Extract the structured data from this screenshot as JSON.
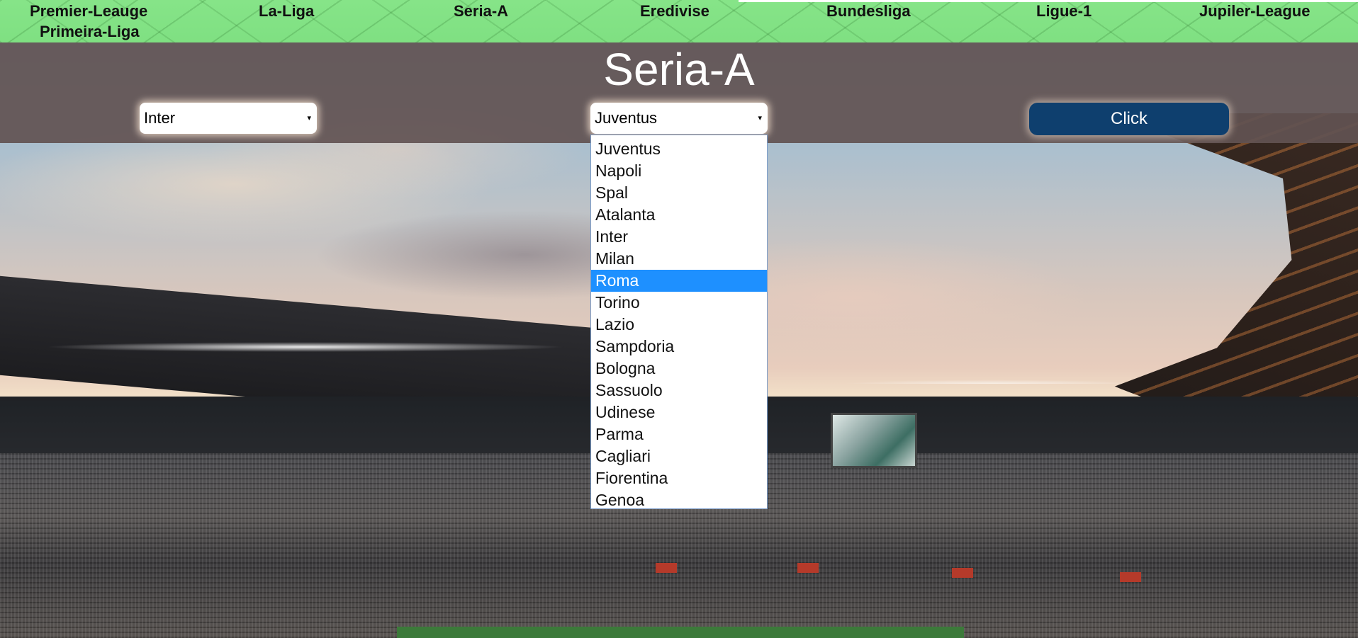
{
  "nav": {
    "items": [
      {
        "label": "Premier-Leauge"
      },
      {
        "label": "Primeira-Liga"
      },
      {
        "label": "La-Liga"
      },
      {
        "label": "Seria-A"
      },
      {
        "label": "Eredivise"
      },
      {
        "label": "Bundesliga"
      },
      {
        "label": "Ligue-1"
      },
      {
        "label": "Jupiler-League"
      }
    ]
  },
  "header": {
    "title": "Seria-A"
  },
  "controls": {
    "team1_selected": "Inter",
    "team2_selected": "Juventus",
    "button_label": "Click",
    "caret_glyph": "▾"
  },
  "dropdown": {
    "options": [
      "Juventus",
      "Napoli",
      "Spal",
      "Atalanta",
      "Inter",
      "Milan",
      "Roma",
      "Torino",
      "Lazio",
      "Sampdoria",
      "Bologna",
      "Sassuolo",
      "Udinese",
      "Parma",
      "Cagliari",
      "Fiorentina",
      "Genoa"
    ],
    "highlighted": "Roma"
  },
  "colors": {
    "nav_bg": "#7fe082",
    "band_bg": "#625252",
    "button_bg": "#0e3f6e",
    "highlight": "#1e90ff"
  }
}
